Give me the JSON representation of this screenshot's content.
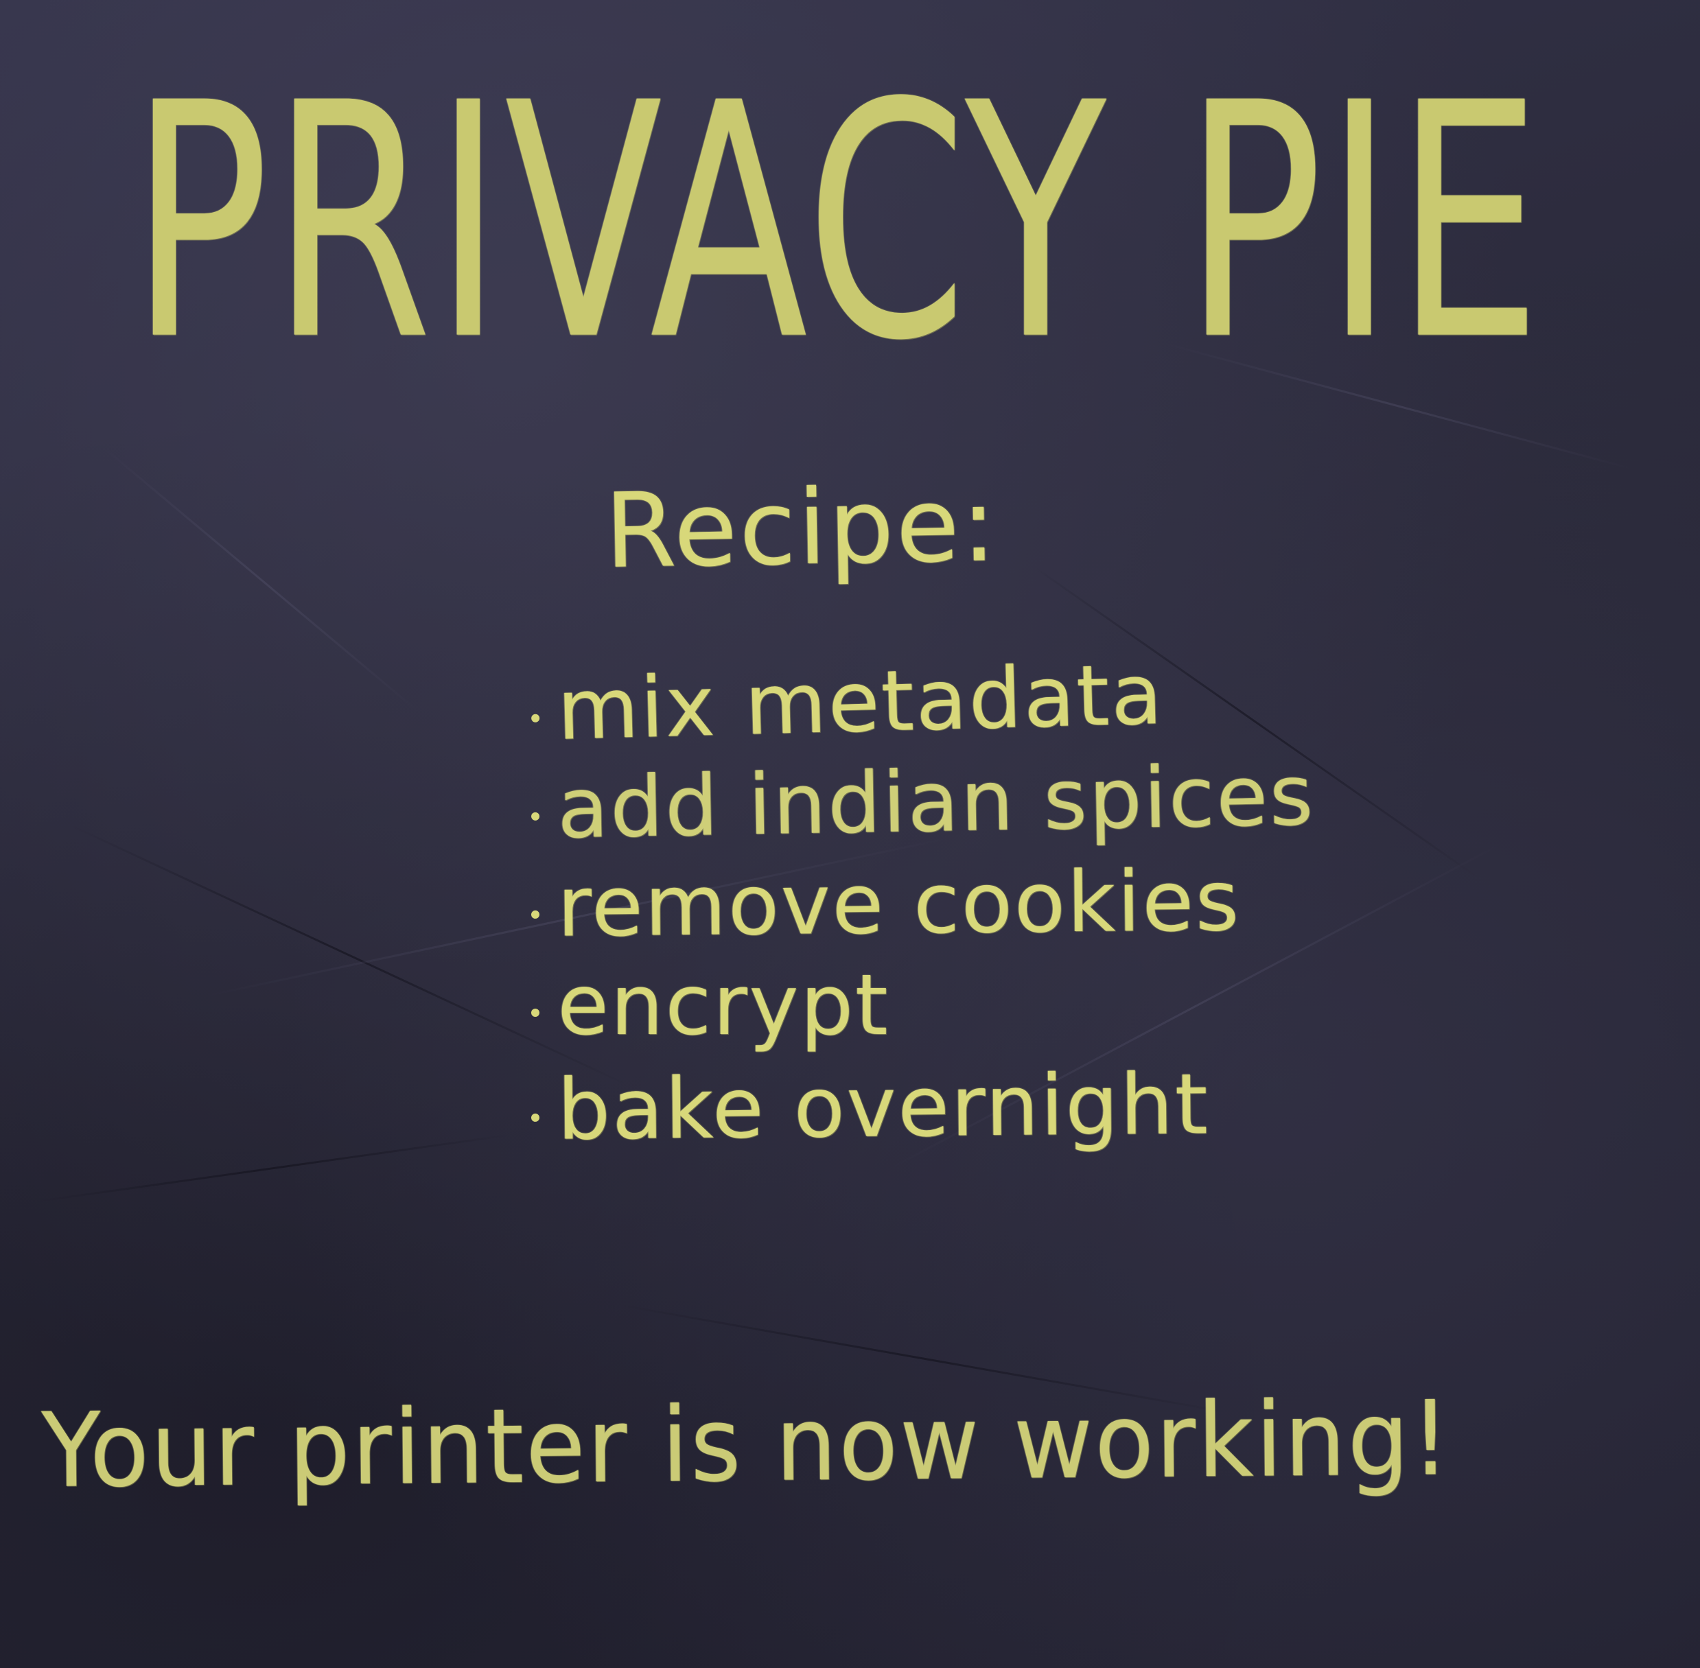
{
  "title": "PRIVACY PIE",
  "recipe": {
    "heading": "Recipe:",
    "steps": [
      "mix metadata",
      "add indian spices",
      "remove cookies",
      "encrypt",
      "bake overnight"
    ]
  },
  "footer": "Your printer is now working!",
  "colors": {
    "background": "#2b2a3a",
    "chalk": "#d8d87a"
  }
}
